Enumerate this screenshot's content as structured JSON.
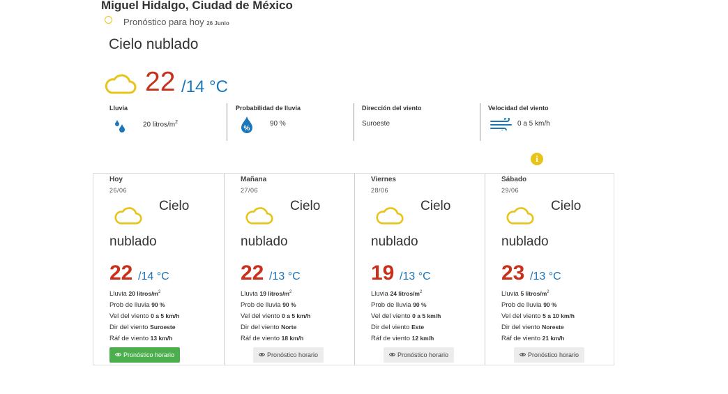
{
  "location": "Miguel Hidalgo, Ciudad de México",
  "forecast_label": "Pronóstico para hoy",
  "forecast_date": "26 Junio",
  "today": {
    "condition": "Cielo nublado",
    "temp_max": "22",
    "temp_min_unit": "/14 °C",
    "icon": "cloud-icon"
  },
  "metrics": {
    "lluvia": {
      "label": "Lluvia",
      "value": "20 litros/m",
      "sup": "2",
      "icon": "rain-drops-icon"
    },
    "prob": {
      "label": "Probabilidad de lluvia",
      "value": "90 %",
      "icon": "rain-probability-icon"
    },
    "dir": {
      "label": "Dirección del viento",
      "value": "Suroeste"
    },
    "vel": {
      "label": "Velocidad del viento",
      "value": "0 a 5 km/h",
      "icon": "wind-icon"
    }
  },
  "colors": {
    "max_temp": "#c8321d",
    "min_temp": "#1a76b9",
    "accent_yellow": "#e8c41a",
    "button_green": "#4cae4c"
  },
  "row_labels": {
    "lluvia": "Lluvia",
    "prob": "Prob de lluvia",
    "vel": "Vel del viento",
    "dir": "Dir del viento",
    "raf": "Ráf de viento"
  },
  "cards": [
    {
      "day": "Hoy",
      "date": "26/06",
      "cond1": "Cielo",
      "cond2": "nublado",
      "tmax": "22",
      "tmin": "/14 °C",
      "lluvia": "20 litros/m",
      "lluvia_sup": "2",
      "prob": "90 %",
      "vel": "0 a 5 km/h",
      "dir": "Suroeste",
      "raf": "13 km/h",
      "button": "Pronóstico horario"
    },
    {
      "day": "Mañana",
      "date": "27/06",
      "cond1": "Cielo",
      "cond2": "nublado",
      "tmax": "22",
      "tmin": "/13 °C",
      "lluvia": "19 litros/m",
      "lluvia_sup": "2",
      "prob": "90 %",
      "vel": "0 a 5 km/h",
      "dir": "Norte",
      "raf": "18 km/h",
      "button": "Pronóstico horario"
    },
    {
      "day": "Viernes",
      "date": "28/06",
      "cond1": "Cielo",
      "cond2": "nublado",
      "tmax": "19",
      "tmin": "/13 °C",
      "lluvia": "24 litros/m",
      "lluvia_sup": "2",
      "prob": "90 %",
      "vel": "0 a 5 km/h",
      "dir": "Este",
      "raf": "12 km/h",
      "button": "Pronóstico horario"
    },
    {
      "day": "Sábado",
      "date": "29/06",
      "cond1": "Cielo",
      "cond2": "nublado",
      "tmax": "23",
      "tmin": "/13 °C",
      "lluvia": "5 litros/m",
      "lluvia_sup": "2",
      "prob": "90 %",
      "vel": "5 a 10 km/h",
      "dir": "Noreste",
      "raf": "21 km/h",
      "button": "Pronóstico horario"
    }
  ]
}
